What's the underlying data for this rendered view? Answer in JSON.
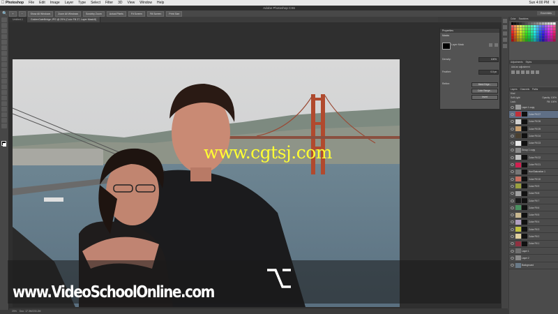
{
  "menubar": {
    "app": "Photoshop",
    "items": [
      "File",
      "Edit",
      "Image",
      "Layer",
      "Type",
      "Select",
      "Filter",
      "3D",
      "View",
      "Window",
      "Help"
    ],
    "right_text": "Sun 4:00 PM",
    "search_icon": "magnifier-icon"
  },
  "window_title": "Adobe Photoshop CS6",
  "optionsbar": {
    "buttons": [
      "Show All Windows",
      "Zoom All Windows",
      "Scrubby Zoom",
      "Actual Pixels",
      "Fit Screen",
      "Fill Screen",
      "Print Size"
    ],
    "workspace": "Essentials"
  },
  "doc_tabs": [
    "Untitled-1",
    "GoldenGateBridge.JPG @ 25% (Color Fill 27, Layer Mask/8)"
  ],
  "status": {
    "zoom": "25%",
    "doc": "Doc: 17.3M/233.2M"
  },
  "properties": {
    "title": "Properties",
    "mode": "Masks",
    "layer_mask_label": "Layer Mask",
    "density_label": "Density:",
    "density_value": "100%",
    "feather_label": "Feather:",
    "feather_value": "0.0 px",
    "refine_label": "Refine:",
    "buttons": [
      "Mask Edge...",
      "Color Range...",
      "Invert"
    ]
  },
  "right_dock": {
    "color_tab": "Color",
    "swatches_tab": "Swatches",
    "adjustments_tab": "Adjustments",
    "styles_tab": "Styles",
    "add_adjustment": "Add an adjustment"
  },
  "layers_panel": {
    "tabs": [
      "Layers",
      "Channels",
      "Paths"
    ],
    "kind": "Kind",
    "blend": "Soft Light",
    "opacity_label": "Opacity:",
    "opacity": "100%",
    "lock_label": "Lock:",
    "fill_label": "Fill:",
    "fill": "100%",
    "rows": [
      {
        "name": "Layer 1 copy",
        "color": "#9a9a9a",
        "mask": false
      },
      {
        "name": "Color Fill 27",
        "color": "#c0303a",
        "mask": true
      },
      {
        "name": "Color Fill 26",
        "color": "#d0d0d0",
        "mask": true
      },
      {
        "name": "Color Fill 25",
        "color": "#c8a070",
        "mask": true
      },
      {
        "name": "Color Fill 24",
        "color": "#4a4030",
        "mask": true
      },
      {
        "name": "Color Fill 23",
        "color": "#e8e8e8",
        "mask": true
      },
      {
        "name": "Group 1 copy",
        "color": "#888888",
        "mask": false
      },
      {
        "name": "Color Fill 22",
        "color": "#c0c0c0",
        "mask": true
      },
      {
        "name": "Color Fill 21",
        "color": "#d02050",
        "mask": true
      },
      {
        "name": "Hue/Saturation 1",
        "color": "#777777",
        "mask": true
      },
      {
        "name": "Color Fill 10",
        "color": "#c87060",
        "mask": true
      },
      {
        "name": "Color Fill 9",
        "color": "#9aa040",
        "mask": true
      },
      {
        "name": "Color Fill 8",
        "color": "#a0a0a0",
        "mask": true
      },
      {
        "name": "Color Fill 7",
        "color": "#1a1a1a",
        "mask": true
      },
      {
        "name": "Color Fill 6",
        "color": "#4a9060",
        "mask": true
      },
      {
        "name": "Color Fill 5",
        "color": "#c8b890",
        "mask": true
      },
      {
        "name": "Color Fill 4",
        "color": "#b0a0c0",
        "mask": true
      },
      {
        "name": "Color Fill 3",
        "color": "#c0c040",
        "mask": true
      },
      {
        "name": "Color Fill 2",
        "color": "#e0d0a0",
        "mask": true
      },
      {
        "name": "Color Fill 1",
        "color": "#903040",
        "mask": true
      },
      {
        "name": "Layer 1",
        "color": "#707070",
        "mask": false
      },
      {
        "name": "Layer 2",
        "color": "#8a8a8a",
        "mask": false
      },
      {
        "name": "Background",
        "color": "#6a7a88",
        "mask": false
      }
    ]
  },
  "overlays": {
    "watermark": "www.cgtsj.com",
    "site": "www.VideoSchoolOnline.com",
    "key_symbol": "⌥"
  }
}
